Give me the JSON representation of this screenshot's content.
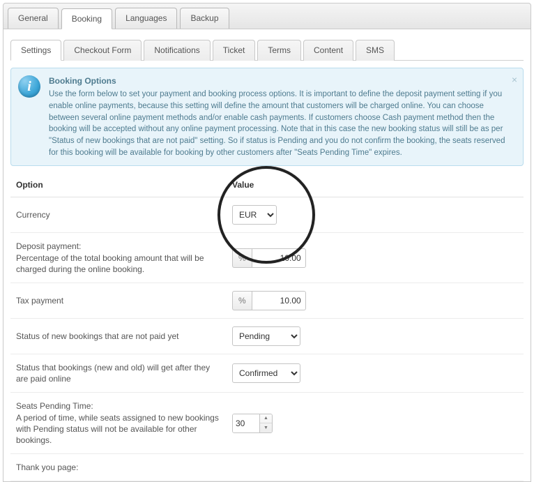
{
  "topTabs": {
    "t0": "General",
    "t1": "Booking",
    "t2": "Languages",
    "t3": "Backup"
  },
  "subTabs": {
    "s0": "Settings",
    "s1": "Checkout Form",
    "s2": "Notifications",
    "s3": "Ticket",
    "s4": "Terms",
    "s5": "Content",
    "s6": "SMS"
  },
  "info": {
    "title": "Booking Options",
    "body": "Use the form below to set your payment and booking process options. It is important to define the deposit payment setting if you enable online payments, because this setting will define the amount that customers will be charged online. You can choose between several online payment methods and/or enable cash payments. If customers choose Cash payment method then the booking will be accepted without any online payment processing. Note that in this case the new booking status will still be as per \"Status of new bookings that are not paid\" setting. So if status is Pending and you do not confirm the booking, the seats reserved for this booking will be available for booking by other customers after \"Seats Pending Time\" expires."
  },
  "headers": {
    "option": "Option",
    "value": "Value"
  },
  "rows": {
    "currency": {
      "label": "Currency",
      "value": "EUR"
    },
    "deposit": {
      "title": "Deposit payment:",
      "desc": "Percentage of the total booking amount that will be charged during the online booking.",
      "unit": "%",
      "value": "10.00"
    },
    "tax": {
      "label": "Tax payment",
      "unit": "%",
      "value": "10.00"
    },
    "statusUnpaid": {
      "label": "Status of new bookings that are not paid yet",
      "value": "Pending"
    },
    "statusPaid": {
      "label": "Status that bookings (new and old) will get after they are paid online",
      "value": "Confirmed"
    },
    "pendingTime": {
      "title": "Seats Pending Time:",
      "desc": "A period of time, while seats assigned to new bookings with Pending status will not be available for other bookings.",
      "value": "30"
    },
    "thankyou": {
      "title": "Thank you page:"
    }
  }
}
